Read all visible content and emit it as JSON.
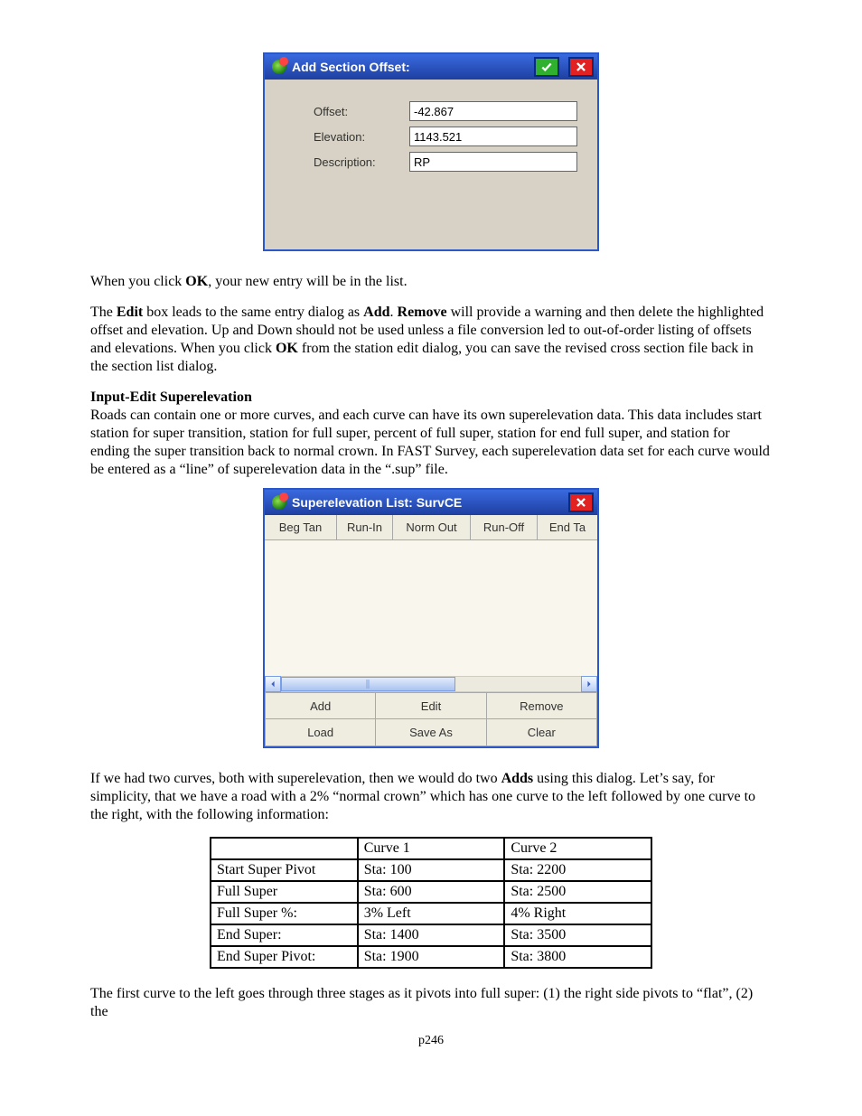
{
  "dialog1": {
    "title": "Add Section Offset:",
    "ok_icon": "check-icon",
    "close_icon": "x-icon",
    "fields": {
      "offset_label": "Offset:",
      "offset_value": "-42.867",
      "elev_label": "Elevation:",
      "elev_value": "1143.521",
      "desc_label": "Description:",
      "desc_value": "RP"
    }
  },
  "para1_a": "When you click ",
  "para1_ok": "OK",
  "para1_b": ", your new entry will be in the list.",
  "para2_a": "The ",
  "para2_edit": "Edit",
  "para2_b": " box leads to the same entry dialog as ",
  "para2_add": "Add",
  "para2_c": ".  ",
  "para2_remove": "Remove",
  "para2_d": " will provide a warning and then delete the highlighted offset and elevation. Up and Down should not be used unless a file conversion led to out-of-order listing of offsets and elevations.  When you click ",
  "para2_ok": "OK",
  "para2_e": " from the station edit dialog, you can save the revised cross section file back in the section list dialog.",
  "heading2": "Input-Edit Superelevation",
  "para3": "Roads can contain one or more curves, and each curve can have its own superelevation data.  This data includes  start station for super transition, station for full super, percent of full super, station for end full super, and station for ending the super transition back to normal crown.  In FAST Survey, each superelevation data set for each curve would be entered as a “line” of superelevation data in the “.sup” file.",
  "dialog2": {
    "title": "Superelevation List: SurvCE",
    "columns": {
      "c0": "Beg Tan",
      "c1": "Run-In",
      "c2": "Norm Out",
      "c3": "Run-Off",
      "c4": "End Ta"
    },
    "buttons": {
      "add": "Add",
      "edit": "Edit",
      "remove": "Remove",
      "load": "Load",
      "saveas": "Save As",
      "clear": "Clear"
    }
  },
  "para4_a": "If we had two curves, both with superelevation, then we would do two ",
  "para4_adds": "Adds",
  "para4_b": " using this dialog.  Let’s say, for simplicity, that we have a road with a 2% “normal crown” which has one curve to the left followed by one curve to the right, with the following information:",
  "table": {
    "h1": "Curve 1",
    "h2": "Curve 2",
    "r1c0": "Start Super Pivot",
    "r1c1": "Sta: 100",
    "r1c2": "Sta: 2200",
    "r2c0": "Full Super",
    "r2c1": "Sta:  600",
    "r2c2": "Sta: 2500",
    "r3c0": "Full Super %:",
    "r3c1": "3% Left",
    "r3c2": "4% Right",
    "r4c0": "End Super:",
    "r4c1": "Sta: 1400",
    "r4c2": "Sta: 3500",
    "r5c0": "End Super Pivot:",
    "r5c1": "Sta: 1900",
    "r5c2": "Sta: 3800"
  },
  "para5": "The first curve to the left goes through three stages as it pivots into full super:  (1)  the right side pivots to “flat”, (2) the",
  "page_number": "p246"
}
